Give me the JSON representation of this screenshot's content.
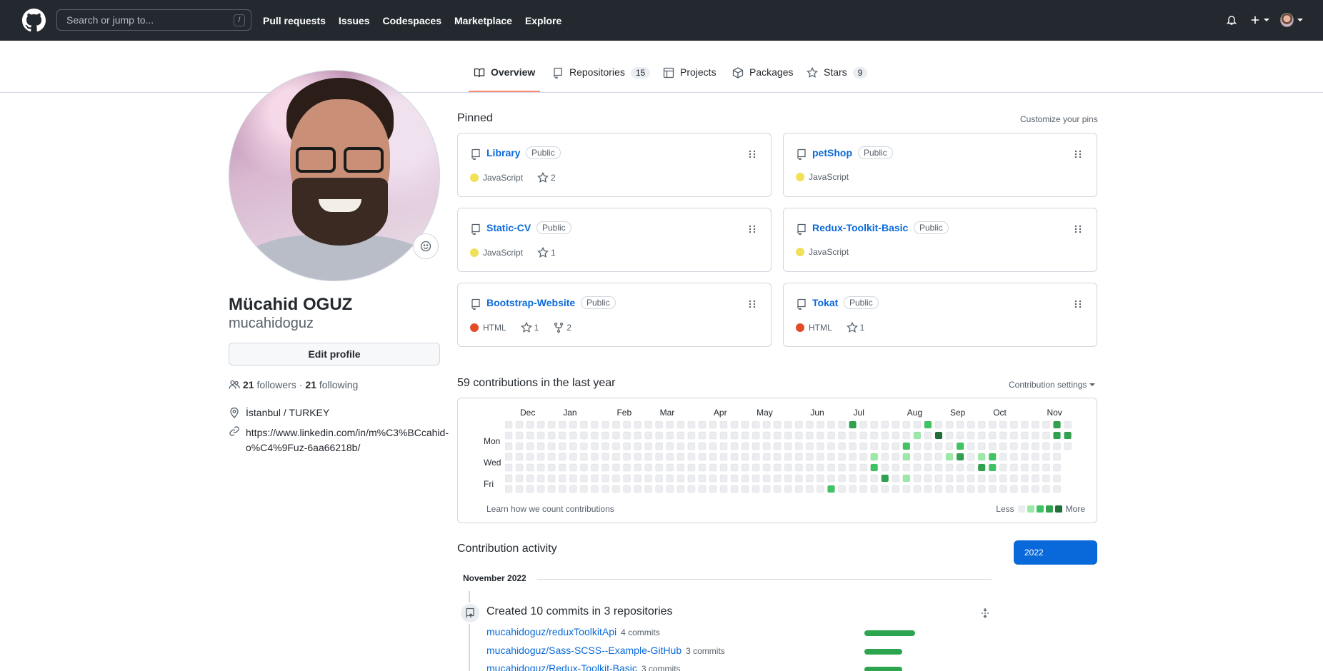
{
  "header": {
    "search_placeholder": "Search or jump to...",
    "search_shortcut": "/",
    "nav": [
      "Pull requests",
      "Issues",
      "Codespaces",
      "Marketplace",
      "Explore"
    ]
  },
  "tabs": [
    {
      "label": "Overview",
      "icon": "book-icon"
    },
    {
      "label": "Repositories",
      "count": "15",
      "icon": "repo-icon"
    },
    {
      "label": "Projects",
      "icon": "table-icon"
    },
    {
      "label": "Packages",
      "icon": "package-icon"
    },
    {
      "label": "Stars",
      "count": "9",
      "icon": "star-icon"
    }
  ],
  "profile": {
    "fullname": "Mücahid OGUZ",
    "username": "mucahidoguz",
    "edit_label": "Edit profile",
    "followers": "21",
    "followers_label": "followers",
    "sep": "·",
    "following": "21",
    "following_label": "following",
    "location": "İstanbul / TURKEY",
    "website": "https://www.linkedin.com/in/m%C3%BCcahid-o%C4%9Fuz-6aa66218b/"
  },
  "pinned": {
    "title": "Pinned",
    "customize": "Customize your pins",
    "repos": [
      {
        "name": "Library",
        "visibility": "Public",
        "lang": "JavaScript",
        "lang_color": "#f1e05a",
        "stars": "2",
        "forks": null
      },
      {
        "name": "petShop",
        "visibility": "Public",
        "lang": "JavaScript",
        "lang_color": "#f1e05a",
        "stars": null,
        "forks": null
      },
      {
        "name": "Static-CV",
        "visibility": "Public",
        "lang": "JavaScript",
        "lang_color": "#f1e05a",
        "stars": "1",
        "forks": null
      },
      {
        "name": "Redux-Toolkit-Basic",
        "visibility": "Public",
        "lang": "JavaScript",
        "lang_color": "#f1e05a",
        "stars": null,
        "forks": null
      },
      {
        "name": "Bootstrap-Website",
        "visibility": "Public",
        "lang": "HTML",
        "lang_color": "#e34c26",
        "stars": "1",
        "forks": "2"
      },
      {
        "name": "Tokat",
        "visibility": "Public",
        "lang": "HTML",
        "lang_color": "#e34c26",
        "stars": "1",
        "forks": null
      }
    ]
  },
  "contributions": {
    "title": "59 contributions in the last year",
    "settings": "Contribution settings",
    "months": [
      "Dec",
      "Jan",
      "Feb",
      "Mar",
      "Apr",
      "May",
      "Jun",
      "Jul",
      "Aug",
      "Sep",
      "Oct",
      "Nov"
    ],
    "days": [
      "Mon",
      "Wed",
      "Fri"
    ],
    "learn": "Learn how we count contributions",
    "less": "Less",
    "more": "More",
    "level_colors": [
      "#ebedf0",
      "#9be9a8",
      "#40c463",
      "#30a14e",
      "#216e39"
    ],
    "cells": [
      {
        "week": 32,
        "day": 1,
        "level": 3
      },
      {
        "week": 39,
        "day": 1,
        "level": 2
      },
      {
        "week": 40,
        "day": 2,
        "level": 4
      },
      {
        "week": 51,
        "day": 1,
        "level": 3
      },
      {
        "week": 51,
        "day": 2,
        "level": 3
      },
      {
        "week": 52,
        "day": 2,
        "level": 3
      },
      {
        "week": 38,
        "day": 2,
        "level": 1
      },
      {
        "week": 37,
        "day": 3,
        "level": 2
      },
      {
        "week": 42,
        "day": 3,
        "level": 2
      },
      {
        "week": 34,
        "day": 4,
        "level": 1
      },
      {
        "week": 37,
        "day": 4,
        "level": 1
      },
      {
        "week": 41,
        "day": 4,
        "level": 1
      },
      {
        "week": 42,
        "day": 4,
        "level": 3
      },
      {
        "week": 44,
        "day": 4,
        "level": 1
      },
      {
        "week": 45,
        "day": 4,
        "level": 2
      },
      {
        "week": 34,
        "day": 5,
        "level": 2
      },
      {
        "week": 44,
        "day": 5,
        "level": 3
      },
      {
        "week": 45,
        "day": 5,
        "level": 2
      },
      {
        "week": 35,
        "day": 6,
        "level": 3
      },
      {
        "week": 37,
        "day": 6,
        "level": 1
      },
      {
        "week": 30,
        "day": 7,
        "level": 2
      }
    ]
  },
  "activity": {
    "title": "Contribution activity",
    "year": "2022",
    "month": "November 2022",
    "commit_summary": "Created 10 commits in 3 repositories",
    "repos": [
      {
        "name": "mucahidoguz/reduxToolkitApi",
        "commits": "4 commits",
        "share": 1.0
      },
      {
        "name": "mucahidoguz/Sass-SCSS--Example-GitHub",
        "commits": "3 commits",
        "share": 0.75
      },
      {
        "name": "mucahidoguz/Redux-Toolkit-Basic",
        "commits": "3 commits",
        "share": 0.75
      }
    ]
  }
}
